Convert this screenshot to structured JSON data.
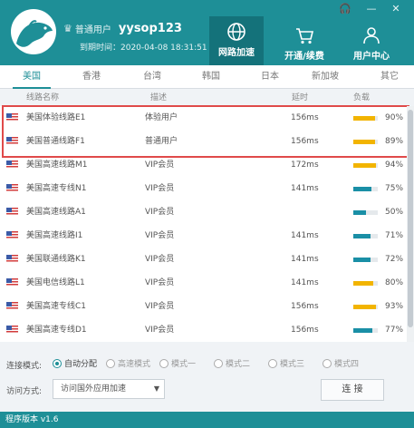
{
  "window": {
    "controls": [
      {
        "icon": "headset-icon",
        "glyph": "🎧"
      },
      {
        "icon": "minimize-icon",
        "glyph": "—"
      },
      {
        "icon": "close-icon",
        "glyph": "✕"
      }
    ]
  },
  "user": {
    "type": "普通用户",
    "name": "yysop123",
    "expiry": "到期时间：2020-04-08 18:31:51"
  },
  "nav": [
    {
      "label": "网路加速",
      "icon": "globe-icon",
      "active": true
    },
    {
      "label": "开通/续费",
      "icon": "cart-icon",
      "active": false
    },
    {
      "label": "用户中心",
      "icon": "users-icon",
      "active": false
    }
  ],
  "tabs": [
    "美国",
    "香港",
    "台湾",
    "韩国",
    "日本",
    "新加坡",
    "其它"
  ],
  "active_tab": 0,
  "columns": {
    "name": "线路名称",
    "desc": "描述",
    "latency": "延时",
    "load": "负载"
  },
  "colors": {
    "accent": "#1e8f97",
    "load_high": "#f2b400",
    "load_low": "#1a8fa6",
    "highlight": "#e04a4a"
  },
  "rows": [
    {
      "name": "美国体验线路E1",
      "desc": "体验用户",
      "latency": "156ms",
      "load": "90%",
      "load_value": 0.9
    },
    {
      "name": "美国普通线路F1",
      "desc": "普通用户",
      "latency": "156ms",
      "load": "89%",
      "load_value": 0.89
    },
    {
      "name": "美国高速线路M1",
      "desc": "VIP会员",
      "latency": "172ms",
      "load": "94%",
      "load_value": 0.94
    },
    {
      "name": "美国高速专线N1",
      "desc": "VIP会员",
      "latency": "141ms",
      "load": "75%",
      "load_value": 0.75
    },
    {
      "name": "美国高速线路A1",
      "desc": "VIP会员",
      "latency": "",
      "load": "50%",
      "load_value": 0.5
    },
    {
      "name": "美国高速线路I1",
      "desc": "VIP会员",
      "latency": "141ms",
      "load": "71%",
      "load_value": 0.71
    },
    {
      "name": "美国联通线路K1",
      "desc": "VIP会员",
      "latency": "141ms",
      "load": "72%",
      "load_value": 0.72
    },
    {
      "name": "美国电信线路L1",
      "desc": "VIP会员",
      "latency": "141ms",
      "load": "80%",
      "load_value": 0.8
    },
    {
      "name": "美国高速专线C1",
      "desc": "VIP会员",
      "latency": "156ms",
      "load": "93%",
      "load_value": 0.93
    },
    {
      "name": "美国高速专线D1",
      "desc": "VIP会员",
      "latency": "156ms",
      "load": "77%",
      "load_value": 0.77
    }
  ],
  "connect_mode": {
    "label": "连接模式:",
    "options": [
      {
        "label": "自动分配",
        "checked": true
      },
      {
        "label": "高速模式",
        "checked": false
      },
      {
        "label": "模式一",
        "checked": false
      },
      {
        "label": "模式二",
        "checked": false
      },
      {
        "label": "模式三",
        "checked": false
      },
      {
        "label": "模式四",
        "checked": false
      }
    ]
  },
  "access": {
    "label": "访问方式:",
    "selected": "访问国外应用加速"
  },
  "connect_button": "连 接",
  "footer": "程序版本 v1.6"
}
